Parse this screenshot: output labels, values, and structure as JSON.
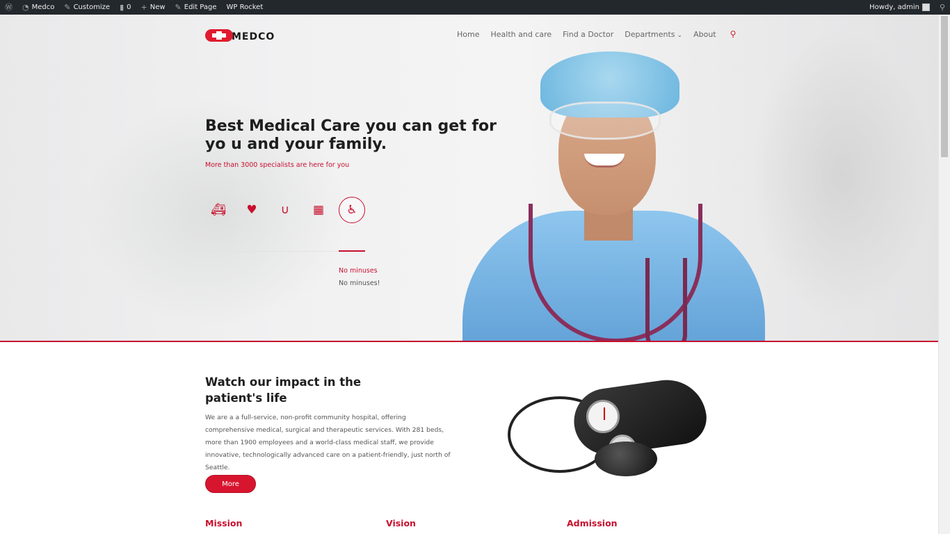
{
  "adminbar": {
    "wp_logo": "wordpress-icon",
    "site_name": "Medco",
    "customize": "Customize",
    "comments_count": "0",
    "new_label": "New",
    "edit_page": "Edit Page",
    "wp_rocket": "WP Rocket",
    "howdy": "Howdy, admin"
  },
  "header": {
    "logo_text": "MEDCO",
    "nav": [
      "Home",
      "Health and care",
      "Find a Doctor",
      "Departments",
      "About"
    ]
  },
  "hero": {
    "title": "Best Medical Care you can get for yo u and your family.",
    "subtitle": "More than 3000 specialists are here for you",
    "icons": [
      "ambulance-icon",
      "heartbeat-icon",
      "stethoscope-icon",
      "hospital-icon",
      "wheelchair-icon"
    ],
    "active_tab_title": "No minuses",
    "active_tab_text": "No minuses!"
  },
  "impact": {
    "title": "Watch our impact in the patient's life",
    "text": "We are a a full-service, non-profit community hospital, offering comprehensive medical, surgical and therapeutic services. With 281 beds, more than 1900 employees and a world-class medical staff, we provide innovative, technologically advanced care on a patient-friendly, just north of Seattle.",
    "button": "More"
  },
  "columns": [
    "Mission",
    "Vision",
    "Admission"
  ],
  "colors": {
    "accent": "#c8102e",
    "adminbar": "#23282d"
  }
}
